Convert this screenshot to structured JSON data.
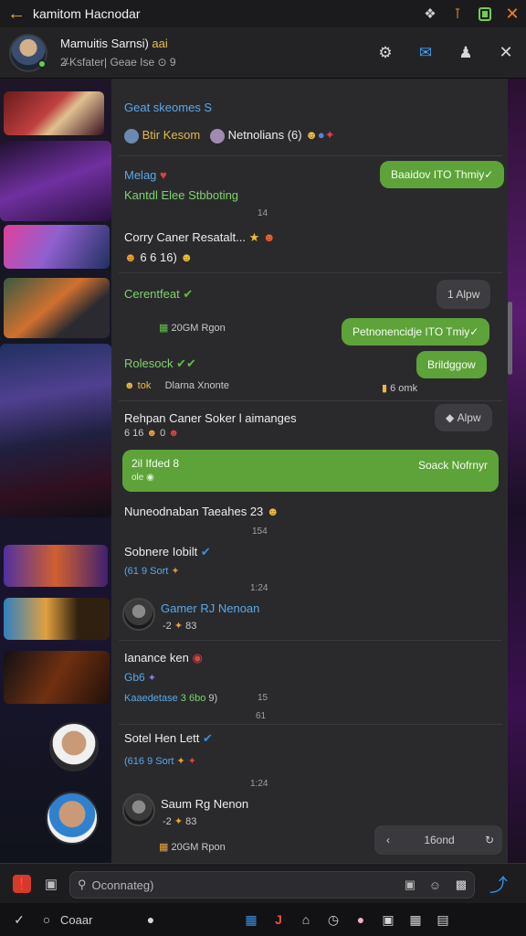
{
  "appbar": {
    "title": "kamitom Hacnodar",
    "icons": [
      "back-arrow-icon",
      "puzzle-icon",
      "fire-icon",
      "battery-icon",
      "close-icon"
    ]
  },
  "chat_header": {
    "name": "Mamuitis Sarnsi)",
    "name_suffix": "aai",
    "subtitle": "2̶̸ Ksfater| Geae Ise ⊙ 9",
    "icons": [
      "settings-icon",
      "bubble-icon",
      "users-icon",
      "close-icon"
    ]
  },
  "messages": [
    {
      "text": "Geat skeomes S"
    },
    {
      "name1": "Btir Kesom",
      "name2": "Netnolians (6)"
    },
    {
      "text": "Melag"
    },
    {
      "text": "Kantdl Elee Stbboting"
    },
    {
      "ts": "14"
    },
    {
      "bubble": "Baaidov ITO Thmiy✓"
    },
    {
      "text": "Corry Caner Resatalt..."
    },
    {
      "text": "6 6 16)"
    },
    {
      "text": "Cerentfeat"
    },
    {
      "bubble": "1  Alpw"
    },
    {
      "text": "20GM Rgon"
    },
    {
      "bubble": "Petnonencidje ITO Tmiy✓"
    },
    {
      "text": "Rolesock"
    },
    {
      "bubble": "Brildggow"
    },
    {
      "text": "tok"
    },
    {
      "text": "Dlarna Xnonte"
    },
    {
      "text": "6 omk"
    },
    {
      "text": "Rehpan Caner Soker l aimanges"
    },
    {
      "text": "6 16"
    },
    {
      "text": "0"
    },
    {
      "bubble": "Alpw"
    },
    {
      "text": "2il Ifded 8"
    },
    {
      "text": "ole"
    },
    {
      "text": "Soack Nofrnyr"
    },
    {
      "text": "Nuneodnaban Taeahes 23"
    },
    {
      "ts": "154"
    },
    {
      "text": "Sobnere Iobilt"
    },
    {
      "text": "(61 9 Sort"
    },
    {
      "ts": "1:24"
    },
    {
      "text": "Gamer RJ Nenoan"
    },
    {
      "text": "-2"
    },
    {
      "text": "83"
    },
    {
      "text": "Ianance ken"
    },
    {
      "text": "Gb6"
    },
    {
      "text": "Kaaedetase"
    },
    {
      "text": "3 6bo"
    },
    {
      "text": "9)"
    },
    {
      "ts": "15"
    },
    {
      "ts": "61"
    },
    {
      "text": "Sotel Hen Lett"
    },
    {
      "text": "(616 9 Sort"
    },
    {
      "ts": "1:24"
    },
    {
      "text": "Saum Rg Nenon"
    },
    {
      "text": "-2"
    },
    {
      "text": "83"
    },
    {
      "text": "20GM Rpon"
    }
  ],
  "jump_bar": {
    "label": "16ond"
  },
  "composer": {
    "placeholder": "Oconnateg)"
  },
  "taskbar": {
    "label": "Coaar"
  },
  "colors": {
    "accent_green": "#5ea23a",
    "link_blue": "#5aa8e8",
    "panel": "#2a2a2d",
    "orange": "#f0a030"
  }
}
